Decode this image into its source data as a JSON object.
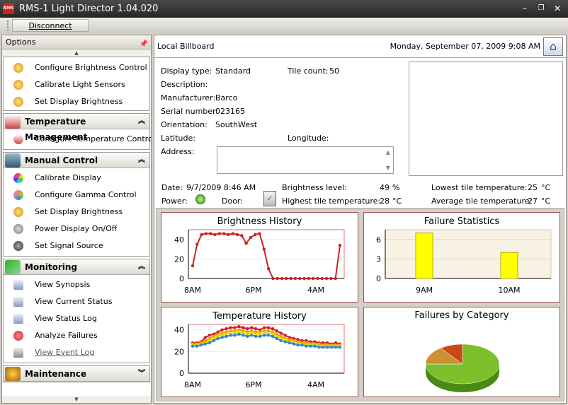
{
  "window": {
    "title": "RMS-1 Light Director 1.04.020",
    "icon_text": "RMS"
  },
  "toolbar": {
    "disconnect": "Disconnect"
  },
  "sidebar": {
    "title": "Options",
    "top_items": [
      {
        "label": "Configure Brightness Control",
        "icon": "sun-gear-icon"
      },
      {
        "label": "Calibrate Light Sensors",
        "icon": "sun-gear-icon"
      },
      {
        "label": "Set Display Brightness",
        "icon": "sun-check-icon"
      }
    ],
    "groups": [
      {
        "title": "Temperature Management",
        "icon": "thermometer-icon",
        "chevron": "up",
        "items": [
          {
            "label": "Configure Temperature Control",
            "icon": "thermometer-icon"
          }
        ]
      },
      {
        "title": "Manual Control",
        "icon": "computer-icon",
        "chevron": "up",
        "items": [
          {
            "label": "Calibrate Display",
            "icon": "color-wheel-icon"
          },
          {
            "label": "Configure Gamma Control",
            "icon": "palette-icon"
          },
          {
            "label": "Set Display Brightness",
            "icon": "sun-check-icon"
          },
          {
            "label": "Power Display On/Off",
            "icon": "power-icon"
          },
          {
            "label": "Set Signal Source",
            "icon": "signal-icon"
          }
        ]
      },
      {
        "title": "Monitoring",
        "icon": "chart-icon",
        "chevron": "up",
        "items": [
          {
            "label": "View Synopsis",
            "icon": "document-icon"
          },
          {
            "label": "View Current Status",
            "icon": "document-icon"
          },
          {
            "label": "View Status Log",
            "icon": "document-icon"
          },
          {
            "label": "Analyze Failures",
            "icon": "error-icon"
          },
          {
            "label": "View Event Log",
            "icon": "log-icon",
            "link": true
          }
        ]
      },
      {
        "title": "Maintenance",
        "icon": "worker-icon",
        "chevron": "down",
        "items": []
      }
    ]
  },
  "header": {
    "location": "Local Billboard",
    "datetime": "Monday, September 07, 2009 9:08 AM"
  },
  "info": {
    "display_type_label": "Display type:",
    "display_type": "Standard",
    "tile_count_label": "Tile count:",
    "tile_count": "50",
    "description_label": "Description:",
    "manufacturer_label": "Manufacturer:",
    "manufacturer": "Barco",
    "serial_label": "Serial number:",
    "serial": "023165",
    "orientation_label": "Orientation:",
    "orientation": "SouthWest",
    "latitude_label": "Latitude:",
    "longitude_label": "Longitude:",
    "address_label": "Address:"
  },
  "status": {
    "date_label": "Date:",
    "date": "9/7/2009 8:46 AM",
    "brightness_label": "Brightness level:",
    "brightness": "49",
    "brightness_unit": "%",
    "low_temp_label": "Lowest tile temperature:",
    "low_temp": "25",
    "low_temp_unit": "°C",
    "power_label": "Power:",
    "door_label": "Door:",
    "high_temp_label": "Highest tile temperature:",
    "high_temp": "28",
    "high_temp_unit": "°C",
    "avg_temp_label": "Average tile temperature:",
    "avg_temp": "27",
    "avg_temp_unit": "°C"
  },
  "chart_data": [
    {
      "type": "line",
      "title": "Brightness History",
      "x_ticks": [
        "8AM",
        "6PM",
        "4AM"
      ],
      "ylim": [
        0,
        50
      ],
      "y_ticks": [
        0,
        20,
        40
      ],
      "series": [
        {
          "color": "#cc2222",
          "values": [
            13,
            35,
            45,
            46,
            46,
            45,
            46,
            46,
            45,
            46,
            45,
            44,
            36,
            42,
            45,
            46,
            30,
            10,
            0,
            0,
            0,
            0,
            0,
            0,
            0,
            0,
            0,
            0,
            0,
            0,
            0,
            0,
            0,
            34
          ]
        }
      ]
    },
    {
      "type": "bar",
      "title": "Failure Statistics",
      "categories": [
        "9AM",
        "10AM"
      ],
      "values": [
        7,
        4
      ],
      "ylim": [
        0,
        7.5
      ],
      "y_ticks": [
        0,
        3,
        6
      ],
      "color": "#ffff00"
    },
    {
      "type": "line",
      "title": "Temperature History",
      "x_ticks": [
        "8AM",
        "6PM",
        "4AM"
      ],
      "ylim": [
        0,
        45
      ],
      "y_ticks": [
        0,
        20,
        40
      ],
      "series": [
        {
          "color": "#cc2222",
          "values": [
            28,
            28,
            29,
            33,
            35,
            36,
            38,
            40,
            41,
            42,
            42,
            43,
            42,
            41,
            42,
            41,
            40,
            42,
            42,
            41,
            39,
            37,
            35,
            33,
            32,
            31,
            30,
            30,
            29,
            29,
            28,
            28,
            28,
            27,
            28,
            27
          ]
        },
        {
          "color": "#ff9900",
          "values": [
            27,
            27,
            28,
            30,
            32,
            34,
            36,
            37,
            38,
            39,
            39,
            40,
            39,
            38,
            39,
            38,
            38,
            39,
            39,
            38,
            36,
            34,
            32,
            31,
            30,
            29,
            28,
            28,
            27,
            27,
            27,
            26,
            26,
            26,
            26,
            26
          ]
        },
        {
          "color": "#e0e000",
          "values": [
            26,
            26,
            27,
            28,
            30,
            32,
            34,
            35,
            36,
            37,
            37,
            38,
            37,
            36,
            37,
            36,
            36,
            37,
            37,
            36,
            34,
            32,
            31,
            29,
            28,
            27,
            27,
            26,
            26,
            26,
            25,
            25,
            25,
            25,
            25,
            25
          ]
        },
        {
          "color": "#3388cc",
          "values": [
            25,
            25,
            26,
            27,
            28,
            30,
            32,
            33,
            34,
            35,
            35,
            36,
            35,
            34,
            35,
            34,
            34,
            35,
            35,
            34,
            32,
            30,
            29,
            28,
            27,
            26,
            26,
            25,
            25,
            25,
            24,
            24,
            24,
            24,
            24,
            24
          ]
        }
      ]
    },
    {
      "type": "pie",
      "title": "Failures by Category",
      "slices": [
        {
          "value": 75,
          "color": "#7cbf2a"
        },
        {
          "value": 15,
          "color": "#d09030"
        },
        {
          "value": 10,
          "color": "#c84818"
        }
      ]
    }
  ]
}
